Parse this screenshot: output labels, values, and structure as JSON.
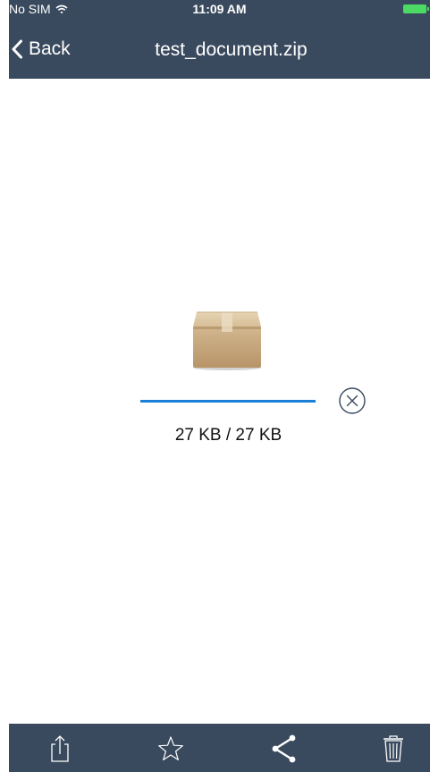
{
  "status_bar": {
    "carrier": "No SIM",
    "time": "11:09 AM",
    "icons": [
      "wifi-icon",
      "battery-icon"
    ]
  },
  "nav": {
    "back_label": "Back",
    "title": "test_document.zip"
  },
  "download": {
    "file_icon": "package-box-icon",
    "progress": 1.0,
    "size_text": "27 KB / 27 KB",
    "cancel_icon": "cancel-circle-icon"
  },
  "toolbar": {
    "items": [
      "open-in-icon",
      "favorite-star-icon",
      "share-icon",
      "trash-icon"
    ]
  },
  "colors": {
    "bar_background": "#3a4a5e",
    "progress": "#1a7fd6",
    "battery": "#4cd964"
  }
}
